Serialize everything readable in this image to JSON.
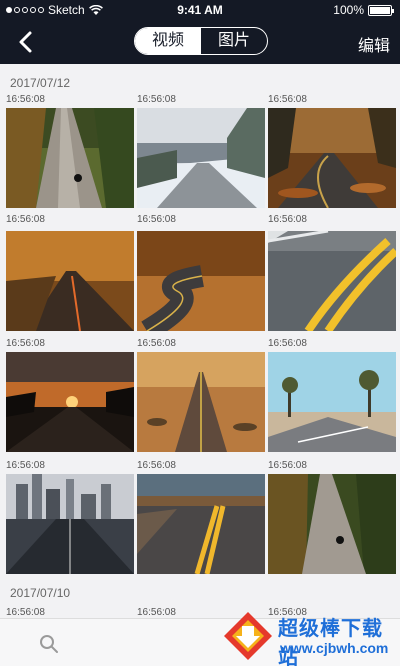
{
  "status_bar": {
    "carrier": "Sketch",
    "time": "9:41 AM",
    "battery": "100%",
    "battery_level": 1.0
  },
  "nav": {
    "tabs": [
      {
        "label": "视频",
        "active": true
      },
      {
        "label": "图片",
        "active": false
      }
    ],
    "edit_label": "编辑"
  },
  "groups": [
    {
      "date": "2017/07/12",
      "items": [
        {
          "time": "16:56:08",
          "scene": "forest-road-motorcycle"
        },
        {
          "time": "16:56:08",
          "scene": "snowy-mountain-road"
        },
        {
          "time": "16:56:08",
          "scene": "autumn-leaves-road"
        },
        {
          "time": "16:56:08",
          "scene": "autumn-wet-road"
        },
        {
          "time": "16:56:08",
          "scene": "winding-autumn-road"
        },
        {
          "time": "16:56:08",
          "scene": "yellow-lines-closeup"
        },
        {
          "time": "16:56:08",
          "scene": "sunset-road"
        },
        {
          "time": "16:56:08",
          "scene": "desert-straight-road"
        },
        {
          "time": "16:56:08",
          "scene": "joshua-tree-road"
        },
        {
          "time": "16:56:08",
          "scene": "city-skyline-road"
        },
        {
          "time": "16:56:08",
          "scene": "coastal-road"
        },
        {
          "time": "16:56:08",
          "scene": "forest-road-motorcycle-2"
        }
      ]
    },
    {
      "date": "2017/07/10",
      "items": [
        {
          "time": "16:56:08",
          "scene": "partial"
        },
        {
          "time": "16:56:08",
          "scene": "partial"
        },
        {
          "time": "16:56:08",
          "scene": "partial"
        }
      ]
    }
  ],
  "bottom_bar": {
    "search_icon": "search-icon"
  },
  "watermark": {
    "title": "超级棒下载站",
    "url": "www.cjbwh.com"
  },
  "colors": {
    "header_bg": "#141925",
    "accent_blue": "#1f6fd8"
  }
}
